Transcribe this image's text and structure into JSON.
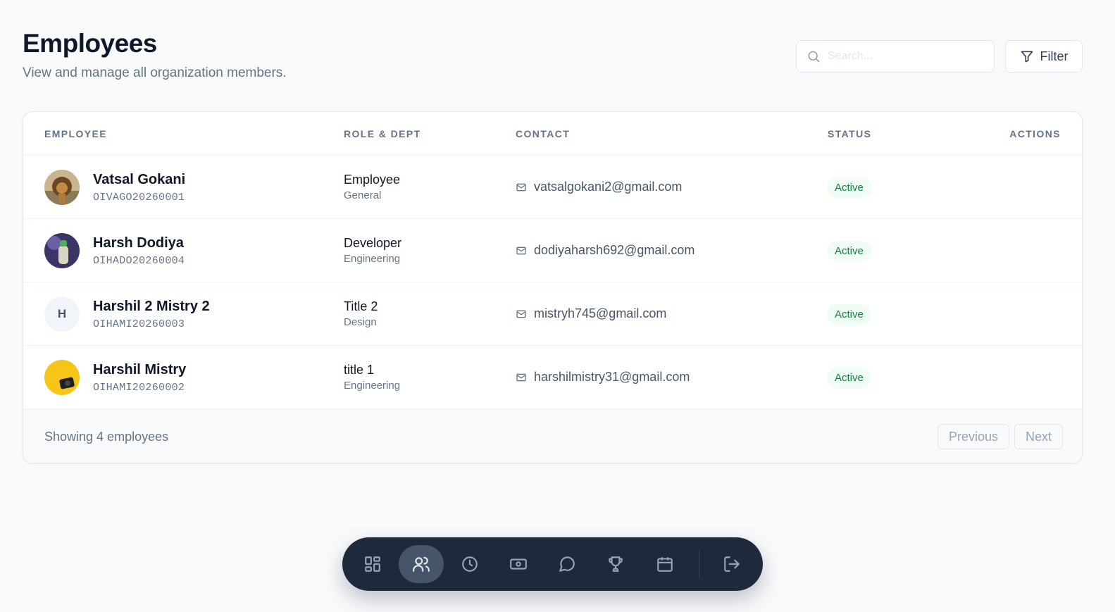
{
  "page": {
    "title": "Employees",
    "subtitle": "View and manage all organization members."
  },
  "search": {
    "placeholder": "Search..."
  },
  "filter": {
    "label": "Filter"
  },
  "table": {
    "columns": [
      "EMPLOYEE",
      "ROLE & DEPT",
      "CONTACT",
      "STATUS",
      "ACTIONS"
    ],
    "rows": [
      {
        "name": "Vatsal Gokani",
        "id": "OIVAGO20260001",
        "role": "Employee",
        "dept": "General",
        "email": "vatsalgokani2@gmail.com",
        "status": "Active",
        "avatar": "lion-photo"
      },
      {
        "name": "Harsh Dodiya",
        "id": "OIHADO20260004",
        "role": "Developer",
        "dept": "Engineering",
        "email": "dodiyaharsh692@gmail.com",
        "status": "Active",
        "avatar": "purple-photo"
      },
      {
        "name": "Harshil 2 Mistry 2",
        "id": "OIHAMI20260003",
        "role": "Title 2",
        "dept": "Design",
        "email": "mistryh745@gmail.com",
        "status": "Active",
        "avatar_initial": "H"
      },
      {
        "name": "Harshil Mistry",
        "id": "OIHAMI20260002",
        "role": "title 1",
        "dept": "Engineering",
        "email": "harshilmistry31@gmail.com",
        "status": "Active",
        "avatar": "yellow-photo"
      }
    ]
  },
  "footer": {
    "summary": "Showing 4 employees",
    "previous": "Previous",
    "next": "Next"
  },
  "dock": {
    "items": [
      "dashboard-icon",
      "users-icon",
      "clock-icon",
      "banknote-icon",
      "chat-icon",
      "trophy-icon",
      "calendar-icon",
      "logout-icon"
    ],
    "active": "users-icon"
  },
  "colors": {
    "background": "#f8fafc",
    "status_bg": "#f0fdf4",
    "status_text": "#15803d",
    "dock_bg": "#1e293b"
  }
}
